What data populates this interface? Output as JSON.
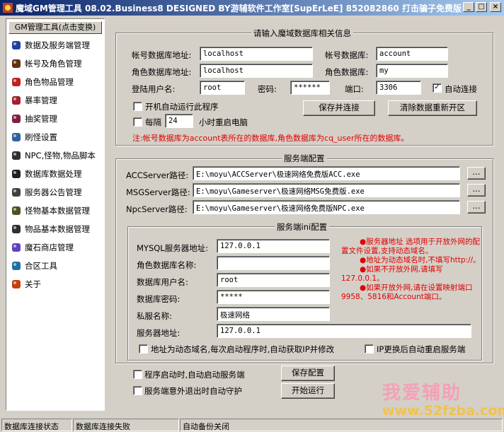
{
  "window": {
    "title": "魔域GM管理工具 08.02.Business8 DESIGNED BY游辅软件工作室[SupErLeE] 852082860 打击骗子免费版!",
    "min": "_",
    "max": "□",
    "close": "×"
  },
  "nav": {
    "header": "GM管理工具(点击变换)",
    "items": [
      {
        "label": "数据及服务端管理",
        "icon": "database-icon"
      },
      {
        "label": "帐号及角色管理",
        "icon": "character-icon"
      },
      {
        "label": "角色物品管理",
        "icon": "item-icon"
      },
      {
        "label": "暴率管理",
        "icon": "drop-rate-icon"
      },
      {
        "label": "抽奖管理",
        "icon": "lottery-icon"
      },
      {
        "label": "刷怪设置",
        "icon": "spawn-icon"
      },
      {
        "label": "NPC,怪物,物品脚本",
        "icon": "script-icon"
      },
      {
        "label": "数据库数据处理",
        "icon": "db-process-icon"
      },
      {
        "label": "服务器公告管理",
        "icon": "announcement-icon"
      },
      {
        "label": "怪物基本数据管理",
        "icon": "monster-icon"
      },
      {
        "label": "物品基本数据管理",
        "icon": "item-data-icon"
      },
      {
        "label": "魔石商店管理",
        "icon": "shop-icon"
      },
      {
        "label": "合区工具",
        "icon": "merge-icon"
      },
      {
        "label": "关于",
        "icon": "about-icon"
      }
    ]
  },
  "db": {
    "title": "请输入魔域数据库相关信息",
    "account_db_addr_label": "帐号数据库地址:",
    "account_db_addr": "localhost",
    "account_db_label": "帐号数据库:",
    "account_db": "account",
    "role_db_addr_label": "角色数据库地址:",
    "role_db_addr": "localhost",
    "role_db_label": "角色数据库:",
    "role_db": "my",
    "user_label": "登陆用户名:",
    "user": "root",
    "password_label": "密码:",
    "password": "******",
    "port_label": "端口:",
    "port": "3306",
    "autoconnect_label": "自动连接",
    "autoconnect_checked": true,
    "autorun_label": "开机自动运行此程序",
    "reboot_prefix": "每隔",
    "reboot_hours": "24",
    "reboot_suffix": "小时重启电脑",
    "save_connect": "保存并连接",
    "clear_data": "清除数据重新开区",
    "note": "注:帐号数据库为account表所在的数据库,角色数据库为cq_user所在的数据库。"
  },
  "server": {
    "title": "服务端配置",
    "acc_label": "ACCServer路径:",
    "acc_path": "E:\\moyu\\ACCServer\\极速网络免费版ACC.exe",
    "msg_label": "MSGServer路径:",
    "msg_path": "E:\\moyu\\Gameserver\\极速网络MSG免费版.exe",
    "npc_label": "NpcServer路径:",
    "npc_path": "E:\\moyu\\Gameserver\\极速网络免费版NPC.exe",
    "browse": "..."
  },
  "ini": {
    "title": "服务端ini配置",
    "mysql_label": "MYSQL服务器地址:",
    "mysql": "127.0.0.1",
    "role_db_name_label": "角色数据库名称:",
    "role_db_name": "",
    "db_user_label": "数据库用户名:",
    "db_user": "root",
    "db_pass_label": "数据库密码:",
    "db_pass": "*****",
    "private_name_label": "私服名称:",
    "private_name": "极速网络",
    "server_addr_label": "服务器地址:",
    "server_addr": "127.0.0.1",
    "help_1": "●服务器地址 选项用于开放外网的配置文件设置,支持动态域名。",
    "help_2": "●地址为动态域名时,不填写http://。",
    "help_3": "●如果不开放外网,请填写127.0.0.1。",
    "help_4": "●如果开放外网,请在设置映射端口9958、5816和Account端口。",
    "dynamic_ip_label": "地址为动态域名,每次启动程序时,自动获取IP并修改",
    "ip_restart_label": "IP更换后自动重启服务端"
  },
  "actions": {
    "auto_start_label": "程序启动时,自动启动服务端",
    "guard_label": "服务端意外退出时自动守护",
    "save_config": "保存配置",
    "start_run": "开始运行"
  },
  "status": {
    "db_state_label": "数据库连接状态",
    "db_state": "数据库连接失败",
    "backup": "自动备份关闭"
  },
  "watermark": {
    "line1": "我爱辅助",
    "line2": "www.52fzba.com"
  }
}
